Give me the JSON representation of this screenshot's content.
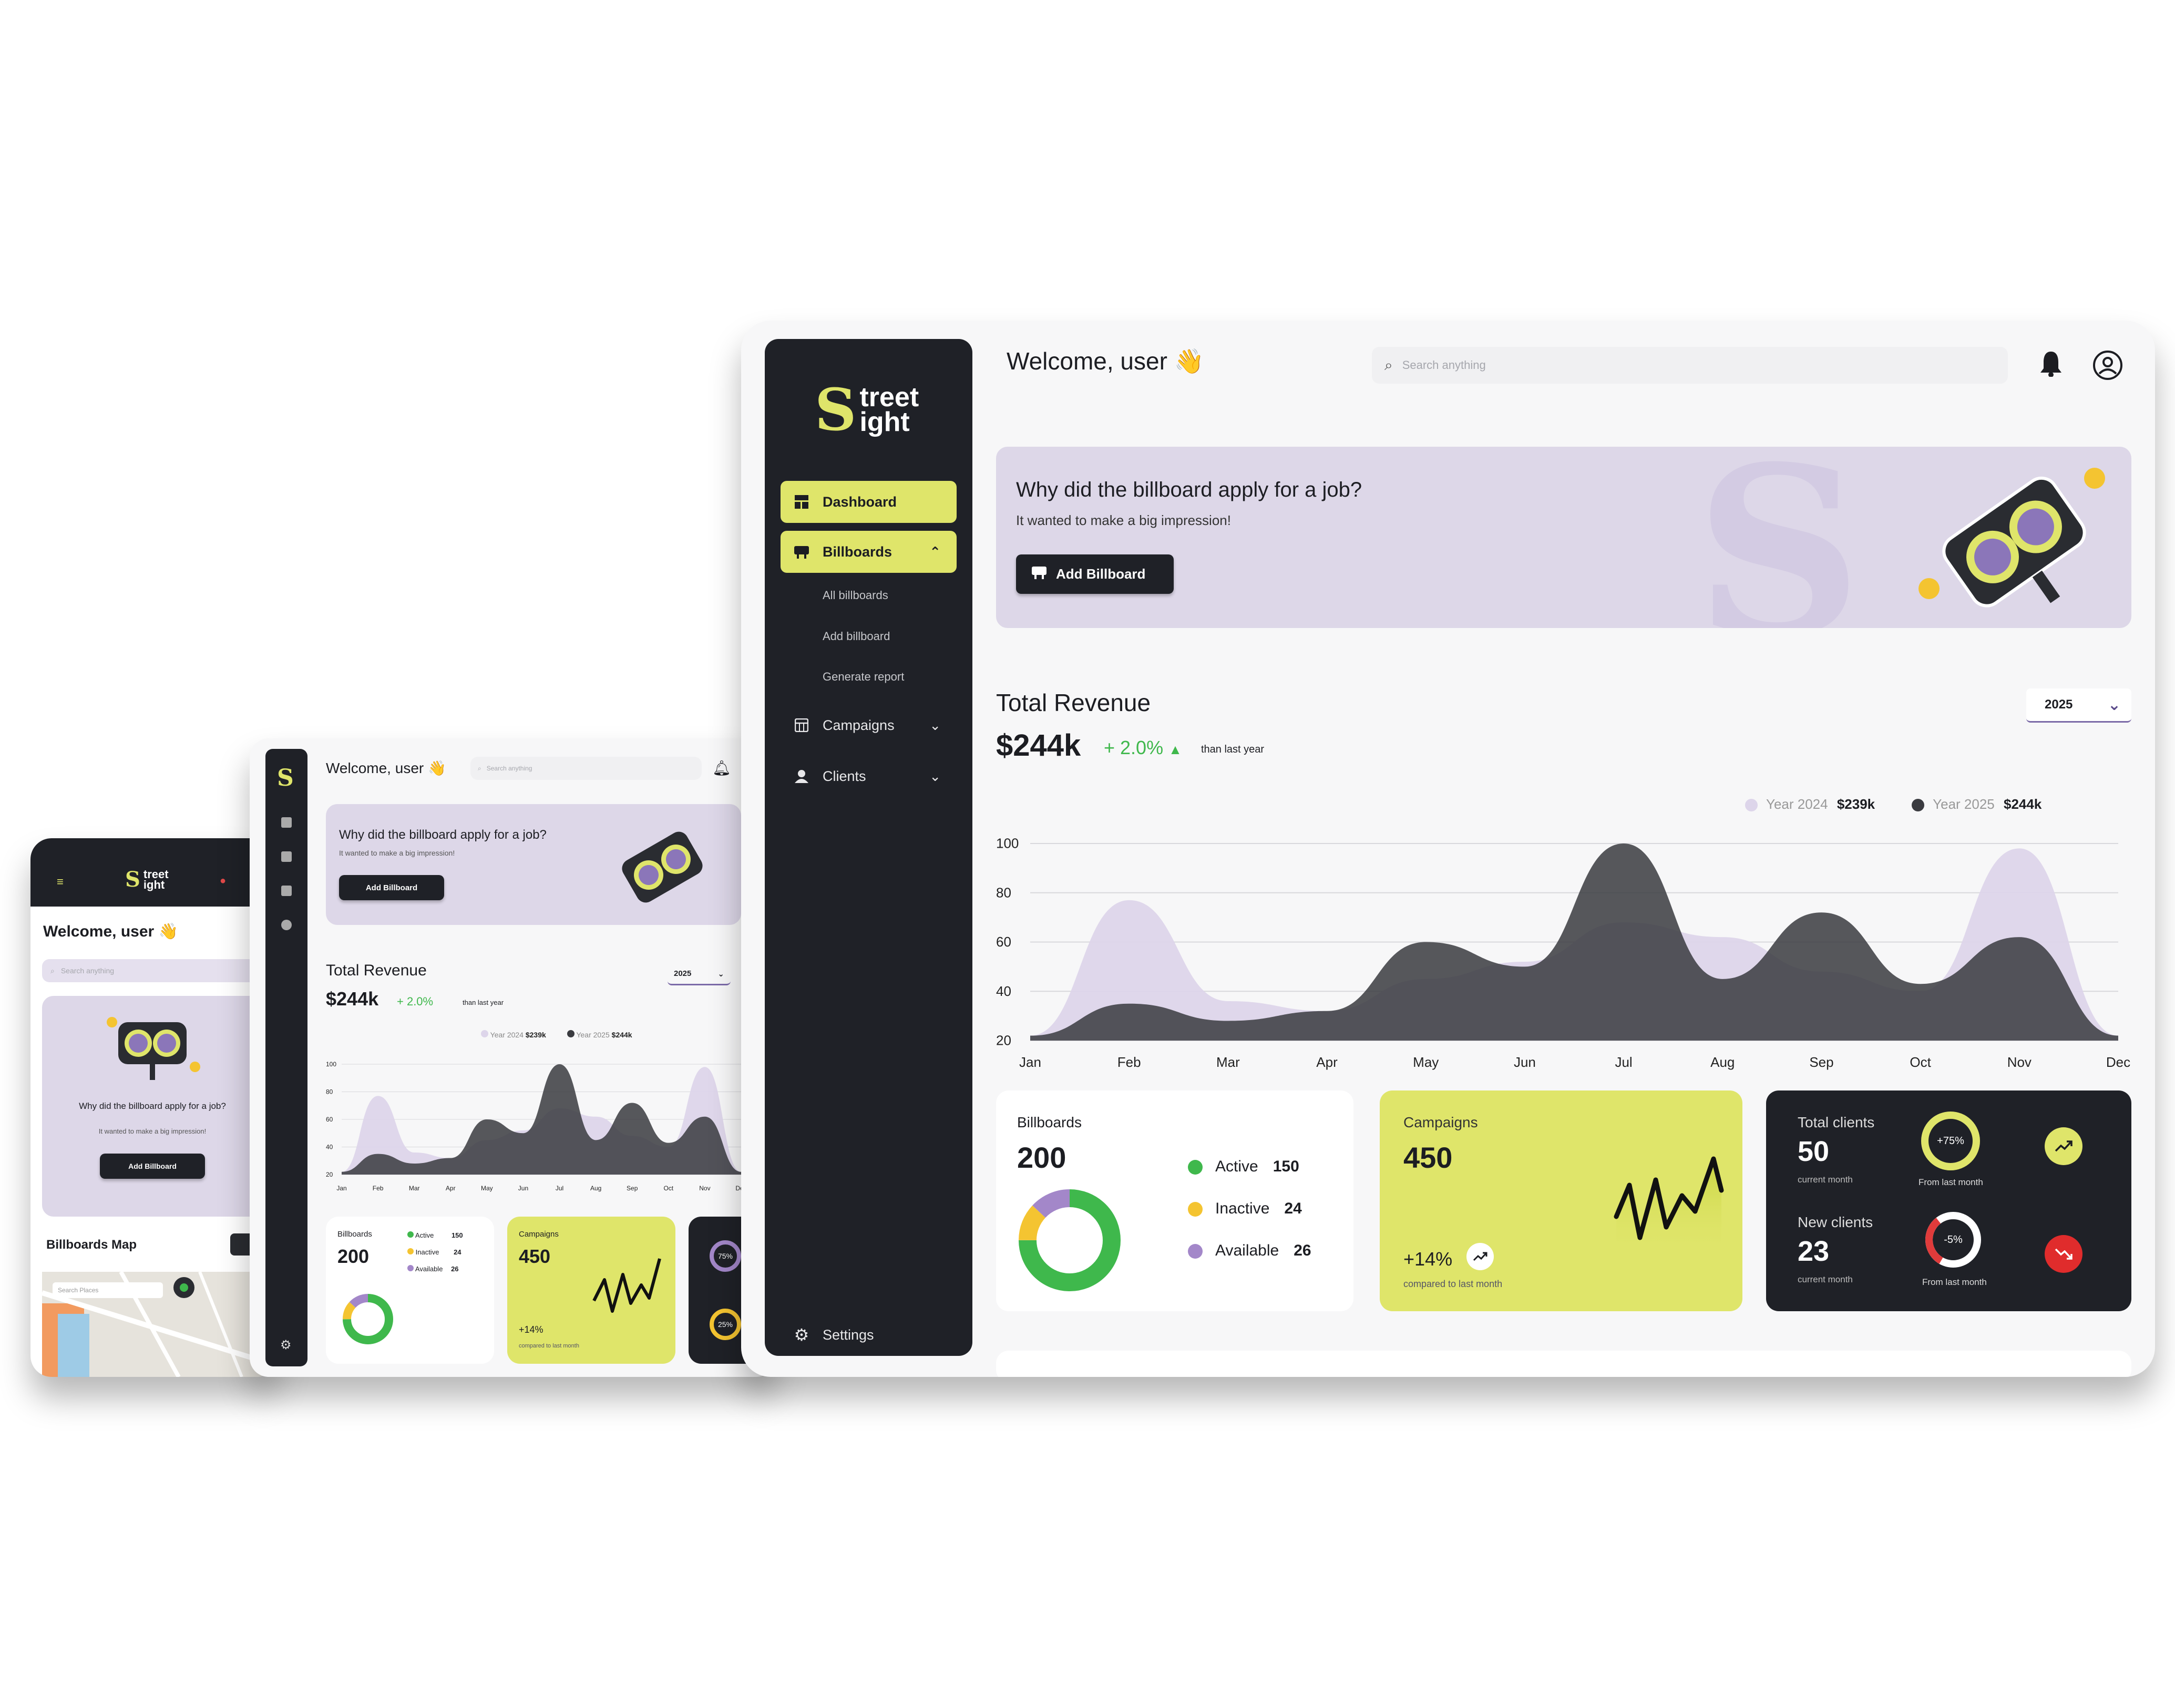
{
  "brand": {
    "logo_line1": "treet",
    "logo_line2": "ight",
    "logo_s": "S"
  },
  "header": {
    "welcome": "Welcome, user 👋",
    "search_placeholder": "Search anything"
  },
  "sidebar": {
    "items": [
      {
        "label": "Dashboard",
        "icon": "dashboard-icon"
      },
      {
        "label": "Billboards",
        "icon": "billboard-icon"
      },
      {
        "label": "Campaigns",
        "icon": "calendar-icon"
      },
      {
        "label": "Clients",
        "icon": "user-icon"
      }
    ],
    "billboard_submenu": [
      "All billboards",
      "Add billboard",
      "Generate report"
    ],
    "settings": "Settings"
  },
  "banner": {
    "title": "Why did the billboard apply for a job?",
    "subtitle": "It wanted to make a big impression!",
    "button": "Add Billboard"
  },
  "revenue": {
    "title": "Total Revenue",
    "amount": "$244k",
    "change": "+ 2.0%",
    "change_short": "+ 2.0%",
    "note": "than last year",
    "year_select": "2025",
    "legend": [
      {
        "label": "Year 2024",
        "value": "$239k",
        "color": "#ddd5ea"
      },
      {
        "label": "Year 2025",
        "value": "$244k",
        "color": "#3a3b40"
      }
    ]
  },
  "chart_data": {
    "type": "area",
    "x": [
      "Jan",
      "Feb",
      "Mar",
      "Apr",
      "May",
      "Jun",
      "Jul",
      "Aug",
      "Sep",
      "Oct",
      "Nov",
      "Dec"
    ],
    "yticks": [
      100,
      80,
      60,
      40,
      20
    ],
    "ylim": [
      20,
      100
    ],
    "series": [
      {
        "name": "Year 2024",
        "values": [
          22,
          77,
          36,
          32,
          45,
          52,
          68,
          62,
          48,
          40,
          98,
          22
        ]
      },
      {
        "name": "Year 2025",
        "values": [
          22,
          35,
          28,
          32,
          60,
          50,
          100,
          45,
          72,
          43,
          62,
          22
        ]
      }
    ]
  },
  "stats": {
    "billboards": {
      "label": "Billboards",
      "value": "200",
      "items": [
        {
          "label": "Active",
          "value": "150",
          "color": "#3fb84c"
        },
        {
          "label": "Inactive",
          "value": "24",
          "color": "#f4c431"
        },
        {
          "label": "Available",
          "value": "26",
          "color": "#a387c9"
        }
      ]
    },
    "campaigns": {
      "label": "Campaigns",
      "value": "450",
      "change": "+14%",
      "note": "compared to last month"
    },
    "total_clients": {
      "label": "Total clients",
      "value": "50",
      "sub": "current month",
      "ring": "+75%",
      "ring_note": "From last month"
    },
    "new_clients": {
      "label": "New clients",
      "value": "23",
      "sub": "current month",
      "ring": "-5%",
      "ring_note": "From last month"
    }
  },
  "tablet": {
    "ring1": "75%",
    "ring2": "25%"
  },
  "phone": {
    "map_title": "Billboards Map",
    "map_search": "Search Places"
  }
}
